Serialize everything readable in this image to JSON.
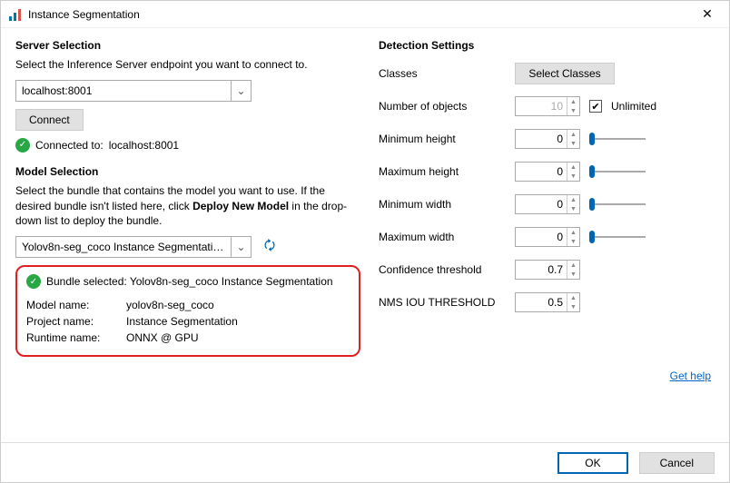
{
  "window": {
    "title": "Instance Segmentation"
  },
  "left": {
    "server_section_title": "Server Selection",
    "server_hint": "Select the Inference Server endpoint you want to connect to.",
    "server_value": "localhost:8001",
    "connect_label": "Connect",
    "connected_prefix": "Connected to:",
    "connected_value": "localhost:8001",
    "model_section_title": "Model Selection",
    "model_hint_1": "Select the bundle that contains the model you want to use. If the desired bundle isn't listed here, click ",
    "model_hint_bold": "Deploy New Model",
    "model_hint_2": " in the drop-down list to deploy the bundle.",
    "model_value": "Yolov8n-seg_coco Instance Segmentati…",
    "bundle_status": "Bundle selected: Yolov8n-seg_coco Instance Segmentation",
    "kv": {
      "model_name_label": "Model name:",
      "model_name_value": "yolov8n-seg_coco",
      "project_name_label": "Project name:",
      "project_name_value": "Instance Segmentation",
      "runtime_name_label": "Runtime name:",
      "runtime_name_value": "ONNX @ GPU"
    }
  },
  "right": {
    "section_title": "Detection Settings",
    "classes_label": "Classes",
    "select_classes_btn": "Select Classes",
    "num_objects_label": "Number of objects",
    "num_objects_value": "10",
    "unlimited_label": "Unlimited",
    "min_height_label": "Minimum height",
    "min_height_value": "0",
    "max_height_label": "Maximum height",
    "max_height_value": "0",
    "min_width_label": "Minimum width",
    "min_width_value": "0",
    "max_width_label": "Maximum width",
    "max_width_value": "0",
    "conf_label": "Confidence threshold",
    "conf_value": "0.7",
    "nms_label": "NMS IOU THRESHOLD",
    "nms_value": "0.5",
    "help_label": "Get help"
  },
  "footer": {
    "ok": "OK",
    "cancel": "Cancel"
  }
}
